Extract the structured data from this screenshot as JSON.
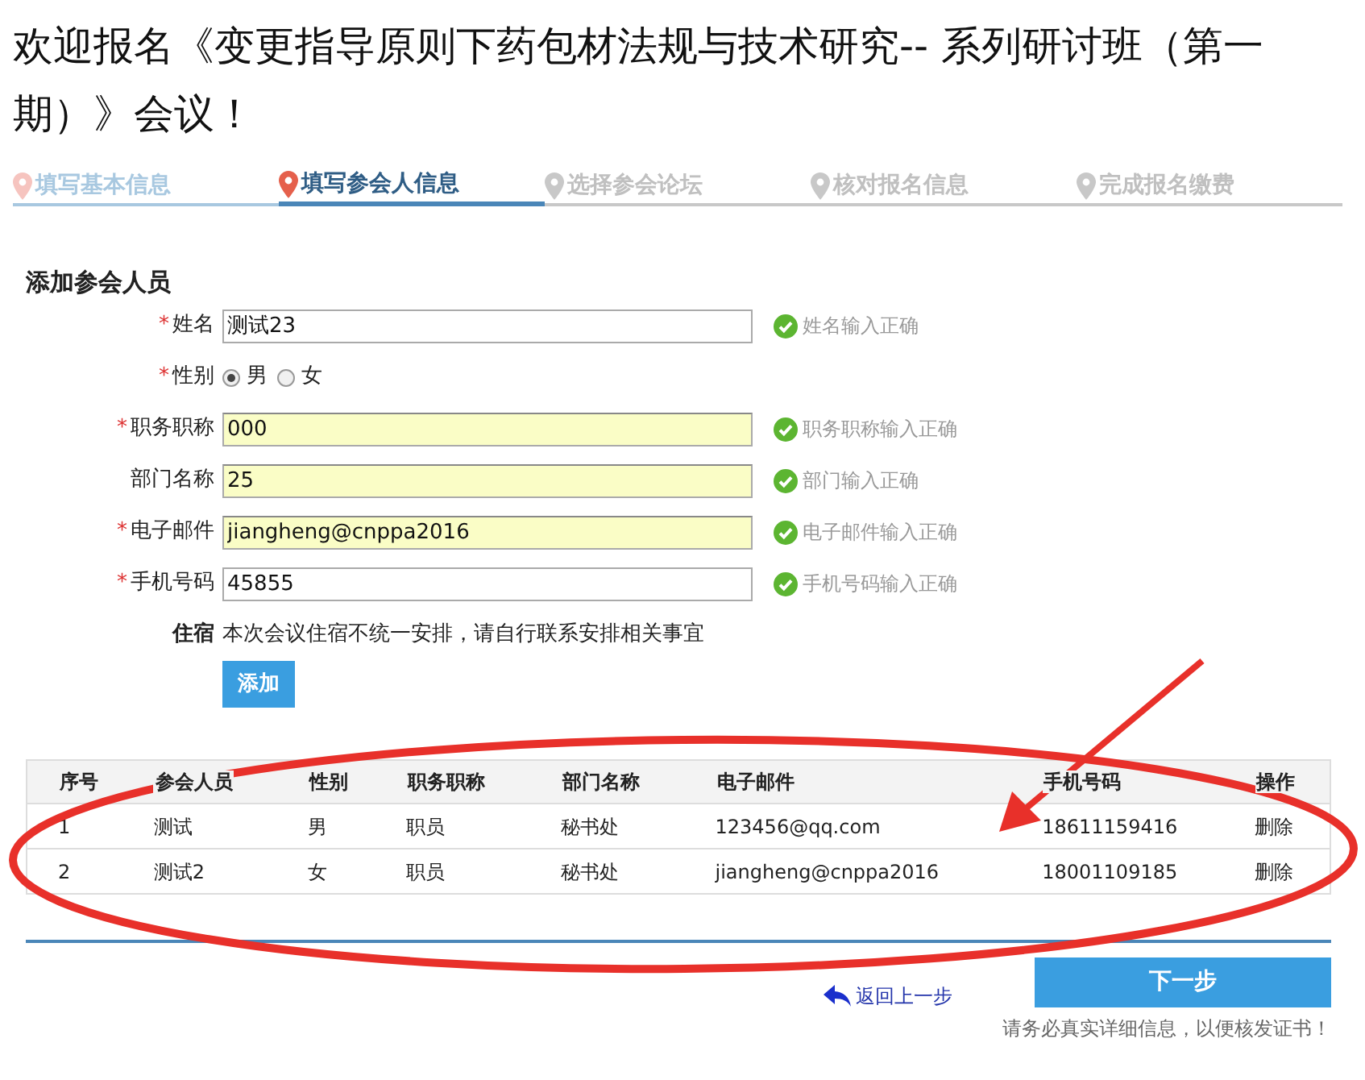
{
  "page_title": "欢迎报名《变更指导原则下药包材法规与技术研究-- 系列研讨班（第一期）》会议！",
  "steps": [
    {
      "label": "填写基本信息",
      "selected": false,
      "completed": true
    },
    {
      "label": "填写参会人信息",
      "selected": true,
      "completed": false
    },
    {
      "label": "选择参会论坛",
      "selected": false,
      "completed": false
    },
    {
      "label": "核对报名信息",
      "selected": false,
      "completed": false
    },
    {
      "label": "完成报名缴费",
      "selected": false,
      "completed": false
    }
  ],
  "section_title": "添加参会人员",
  "fields": [
    {
      "kind": "text",
      "label": "姓名",
      "required": true,
      "value": "测试23",
      "autofilled": false,
      "message": "姓名输入正确",
      "valid": true
    },
    {
      "kind": "radio",
      "label": "性别",
      "required": true,
      "options": [
        {
          "label": "男",
          "selected": true
        },
        {
          "label": "女",
          "selected": false
        }
      ]
    },
    {
      "kind": "text",
      "label": "职务职称",
      "required": true,
      "value": "000",
      "autofilled": true,
      "message": "职务职称输入正确",
      "valid": true
    },
    {
      "kind": "text",
      "label": "部门名称",
      "required": false,
      "value": "25",
      "autofilled": true,
      "message": "部门输入正确",
      "valid": true
    },
    {
      "kind": "text",
      "label": "电子邮件",
      "required": true,
      "value": "jiangheng@cnppa2016",
      "autofilled": true,
      "message": "电子邮件输入正确",
      "valid": true
    },
    {
      "kind": "text",
      "label": "手机号码",
      "required": true,
      "value": "45855",
      "autofilled": false,
      "message": "手机号码输入正确",
      "valid": true
    },
    {
      "kind": "note",
      "label": "住宿",
      "text": "本次会议住宿不统一安排，请自行联系安排相关事宜"
    }
  ],
  "add_button": "添加",
  "required_mark": "*",
  "table": {
    "columns": [
      "序号",
      "参会人员",
      "性别",
      "职务职称",
      "部门名称",
      "电子邮件",
      "手机号码",
      "操作"
    ],
    "rows": [
      [
        "1",
        "测试",
        "男",
        "职员",
        "秘书处",
        "123456@qq.com",
        "18611159416",
        "删除"
      ],
      [
        "2",
        "测试2",
        "女",
        "职员",
        "秘书处",
        "jiangheng@cnppa2016",
        "18001109185",
        "删除"
      ]
    ]
  },
  "back_link": "返回上一步",
  "next_button": "下一步",
  "footer_note": "请务必真实详细信息，以便核发证书！"
}
